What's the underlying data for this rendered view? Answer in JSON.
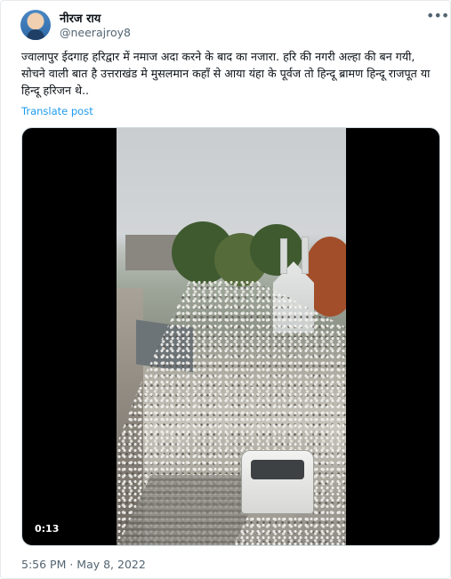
{
  "author": {
    "display_name": "नीरज राय",
    "handle": "@neerajroy8"
  },
  "tweet": {
    "text": "ज्वालापुर ईदगाह हरिद्वार में नमाज अदा करने के बाद का नजारा. हरि की नगरी अल्हा की बन गयी, सोचने वाली बात है उत्तराखंड मे मुसलमान कहाँ से आया यंहा के पूर्वज तो हिन्दू ब्रामण हिन्दू राजपूत या हिन्दू हरिजन थे..",
    "translate_label": "Translate post",
    "timestamp": "5:56 PM · May 8, 2022"
  },
  "video": {
    "duration": "0:13"
  },
  "icons": {
    "more": "more-horizontal-icon"
  },
  "colors": {
    "link": "#1d9bf0",
    "secondary_text": "#536471",
    "primary_text": "#0f1419"
  }
}
